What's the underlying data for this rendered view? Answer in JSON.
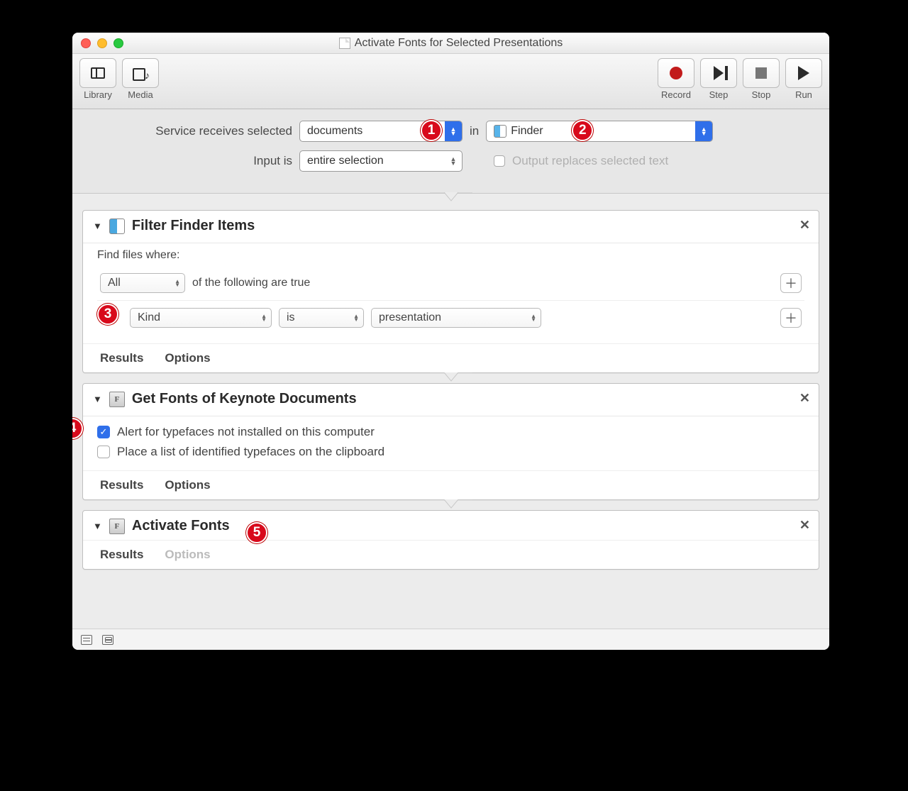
{
  "window": {
    "title": "Activate Fonts for Selected Presentations"
  },
  "toolbar": {
    "left": [
      {
        "label": "Library",
        "name": "library-button"
      },
      {
        "label": "Media",
        "name": "media-button"
      }
    ],
    "right": [
      {
        "label": "Record",
        "name": "record-button"
      },
      {
        "label": "Step",
        "name": "step-button"
      },
      {
        "label": "Stop",
        "name": "stop-button"
      },
      {
        "label": "Run",
        "name": "run-button"
      }
    ]
  },
  "config": {
    "receives_label": "Service receives selected",
    "receives_value": "documents",
    "in_label": "in",
    "app_value": "Finder",
    "input_is_label": "Input is",
    "input_is_value": "entire selection",
    "output_replaces_label": "Output replaces selected text",
    "output_replaces_checked": false
  },
  "actions": [
    {
      "title": "Filter Finder Items",
      "icon": "finder",
      "body": {
        "prompt": "Find files where:",
        "match": {
          "scope": "All",
          "suffix": "of the following are true"
        },
        "rules": [
          {
            "attr": "Kind",
            "op": "is",
            "value": "presentation"
          }
        ]
      },
      "footer": {
        "results": "Results",
        "options": "Options",
        "options_enabled": true
      }
    },
    {
      "title": "Get Fonts of Keynote Documents",
      "icon": "font",
      "checks": [
        {
          "label": "Alert for typefaces not installed on this computer",
          "checked": true
        },
        {
          "label": "Place a list of identified typefaces on the clipboard",
          "checked": false
        }
      ],
      "footer": {
        "results": "Results",
        "options": "Options",
        "options_enabled": true
      }
    },
    {
      "title": "Activate Fonts",
      "icon": "font",
      "footer": {
        "results": "Results",
        "options": "Options",
        "options_enabled": false
      }
    }
  ],
  "annotations": {
    "1": "1",
    "2": "2",
    "3": "3",
    "4": "4",
    "5": "5"
  }
}
